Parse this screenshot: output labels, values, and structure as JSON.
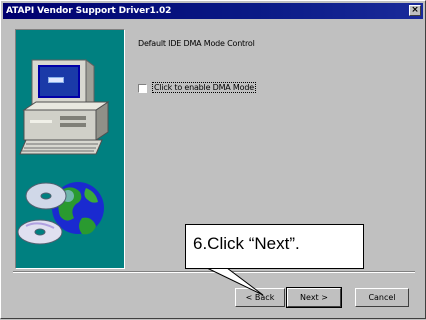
{
  "window": {
    "title": "ATAPI Vendor Support Driver1.02",
    "close_glyph": "×"
  },
  "main": {
    "heading": "Default IDE DMA Mode Control",
    "checkbox_label": "Click to enable DMA Mode",
    "checkbox_checked": false
  },
  "buttons": {
    "back": "< Back",
    "next": "Next >",
    "cancel": "Cancel"
  },
  "callout": {
    "text": "6.Click “Next”."
  },
  "colors": {
    "panel": "#008080",
    "titlebar": "#00006e",
    "face": "#c0c0c0"
  }
}
